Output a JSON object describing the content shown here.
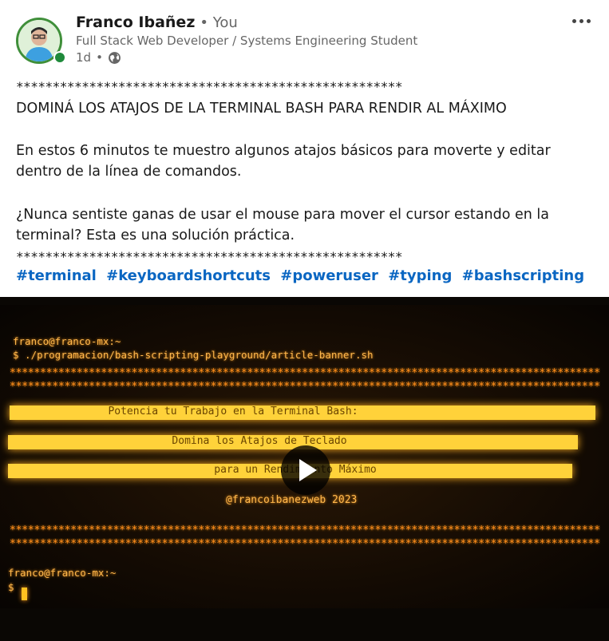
{
  "author": {
    "name": "Franco Ibañez",
    "you_label": "• You",
    "headline": "Full Stack Web Developer / Systems Engineering Student",
    "time": "1d",
    "time_sep": "•",
    "visibility_icon": "globe-icon",
    "online": true
  },
  "post": {
    "stars_top": "*****************************************************",
    "title": "DOMINÁ LOS ATAJOS DE LA TERMINAL BASH PARA RENDIR AL MÁXIMO",
    "para1": "En estos 6 minutos te muestro algunos atajos básicos para moverte y editar dentro de la línea de comandos.",
    "para2": "¿Nunca sentiste ganas de usar el mouse para mover el cursor estando en la terminal? Esta es una solución práctica.",
    "stars_bottom": "*****************************************************",
    "hashtags": [
      "#terminal",
      "#keyboardshortcuts",
      "#poweruser",
      "#typing",
      "#bashscripting"
    ]
  },
  "video": {
    "prompt_top": "franco@franco-mx:~",
    "command": "$ ./programacion/bash-scripting-playground/article-banner.sh",
    "stars": "********************************************************************************************************",
    "banner_line1": "Potencia tu Trabajo en la Terminal Bash:",
    "banner_line2": "Domina los Atajos de Teclado",
    "banner_line3": "para un Rendimiento Máximo",
    "handle": "@francoibanezweb 2023",
    "prompt_bottom": "franco@franco-mx:~",
    "prompt_symbol": "$",
    "play_icon": "play-icon"
  },
  "colors": {
    "hashtag": "#0a66c2",
    "presence": "#1f8a3b",
    "terminal_text": "#ffb84d",
    "banner": "#ffd23a"
  }
}
